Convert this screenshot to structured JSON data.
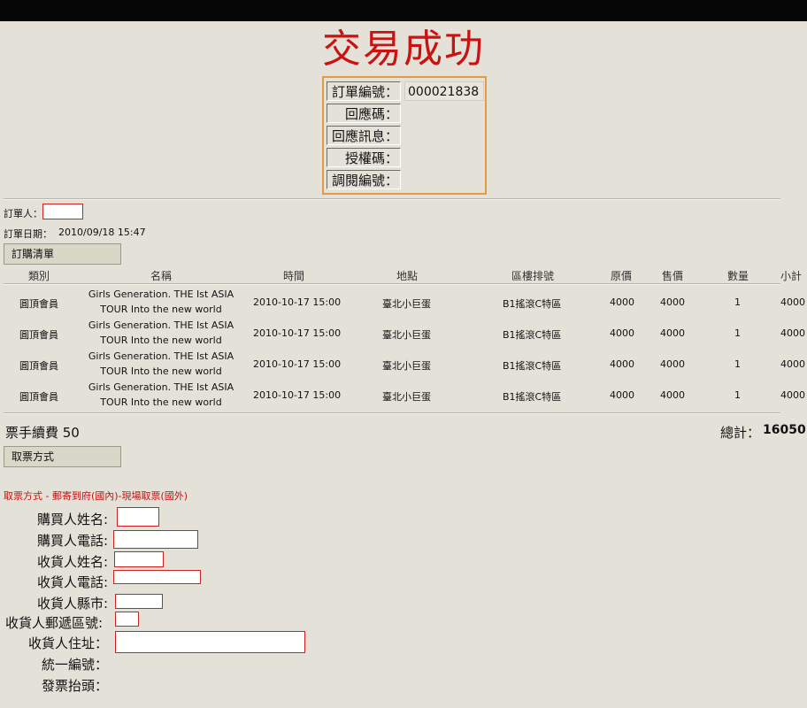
{
  "title": "交易成功",
  "order_info": {
    "order_number_label": "訂單編號：",
    "order_number": "000021838",
    "response_code_label": "回應碼：",
    "response_message_label": "回應訊息：",
    "auth_code_label": "授權碼：",
    "acquirer_number_label": "調閱編號："
  },
  "orderer_label": "訂單人：",
  "order_date_label": "訂單日期：",
  "order_date": "2010/09/18 15:47",
  "order_list_button": "訂購清單",
  "table": {
    "headers": [
      "類別",
      "名稱",
      "時間",
      "地點",
      "區樓排號",
      "原價",
      "售價",
      "數量",
      "小計"
    ],
    "rows": [
      {
        "category": "圓頂會員",
        "name_line1": "Girls Generation. THE Ist ASIA",
        "name_line2": "TOUR Into the new world",
        "time": "2010-10-17 15:00",
        "venue": "臺北小巨蛋",
        "seat": "B1搖滾C特區",
        "original_price": "4000",
        "price": "4000",
        "qty": "1",
        "subtotal": "4000"
      },
      {
        "category": "圓頂會員",
        "name_line1": "Girls Generation. THE Ist ASIA",
        "name_line2": "TOUR Into the new world",
        "time": "2010-10-17 15:00",
        "venue": "臺北小巨蛋",
        "seat": "B1搖滾C特區",
        "original_price": "4000",
        "price": "4000",
        "qty": "1",
        "subtotal": "4000"
      },
      {
        "category": "圓頂會員",
        "name_line1": "Girls Generation. THE Ist ASIA",
        "name_line2": "TOUR Into the new world",
        "time": "2010-10-17 15:00",
        "venue": "臺北小巨蛋",
        "seat": "B1搖滾C特區",
        "original_price": "4000",
        "price": "4000",
        "qty": "1",
        "subtotal": "4000"
      },
      {
        "category": "圓頂會員",
        "name_line1": "Girls Generation. THE Ist ASIA",
        "name_line2": "TOUR Into the new world",
        "time": "2010-10-17 15:00",
        "venue": "臺北小巨蛋",
        "seat": "B1搖滾C特區",
        "original_price": "4000",
        "price": "4000",
        "qty": "1",
        "subtotal": "4000"
      }
    ]
  },
  "fee_label": "票手續費 50",
  "total_label": "總計：",
  "total_value": "16050",
  "pickup_button": "取票方式",
  "pickup_method_text": "取票方式 - 郵寄到府(國內)-現場取票(國外)",
  "form": {
    "buyer_name": "購買人姓名:",
    "buyer_phone": "購買人電話:",
    "recipient_name": "收貨人姓名:",
    "recipient_phone": "收貨人電話:",
    "recipient_city": "收貨人縣市:",
    "recipient_zip": "收貨人郵遞區號:",
    "recipient_address": "收貨人住址：",
    "tax_id": "統一編號：",
    "invoice_title": "發票抬頭："
  },
  "colors": {
    "accent_red": "#cc1111",
    "box_orange": "#e39a44",
    "background": "#e4e2d8"
  }
}
